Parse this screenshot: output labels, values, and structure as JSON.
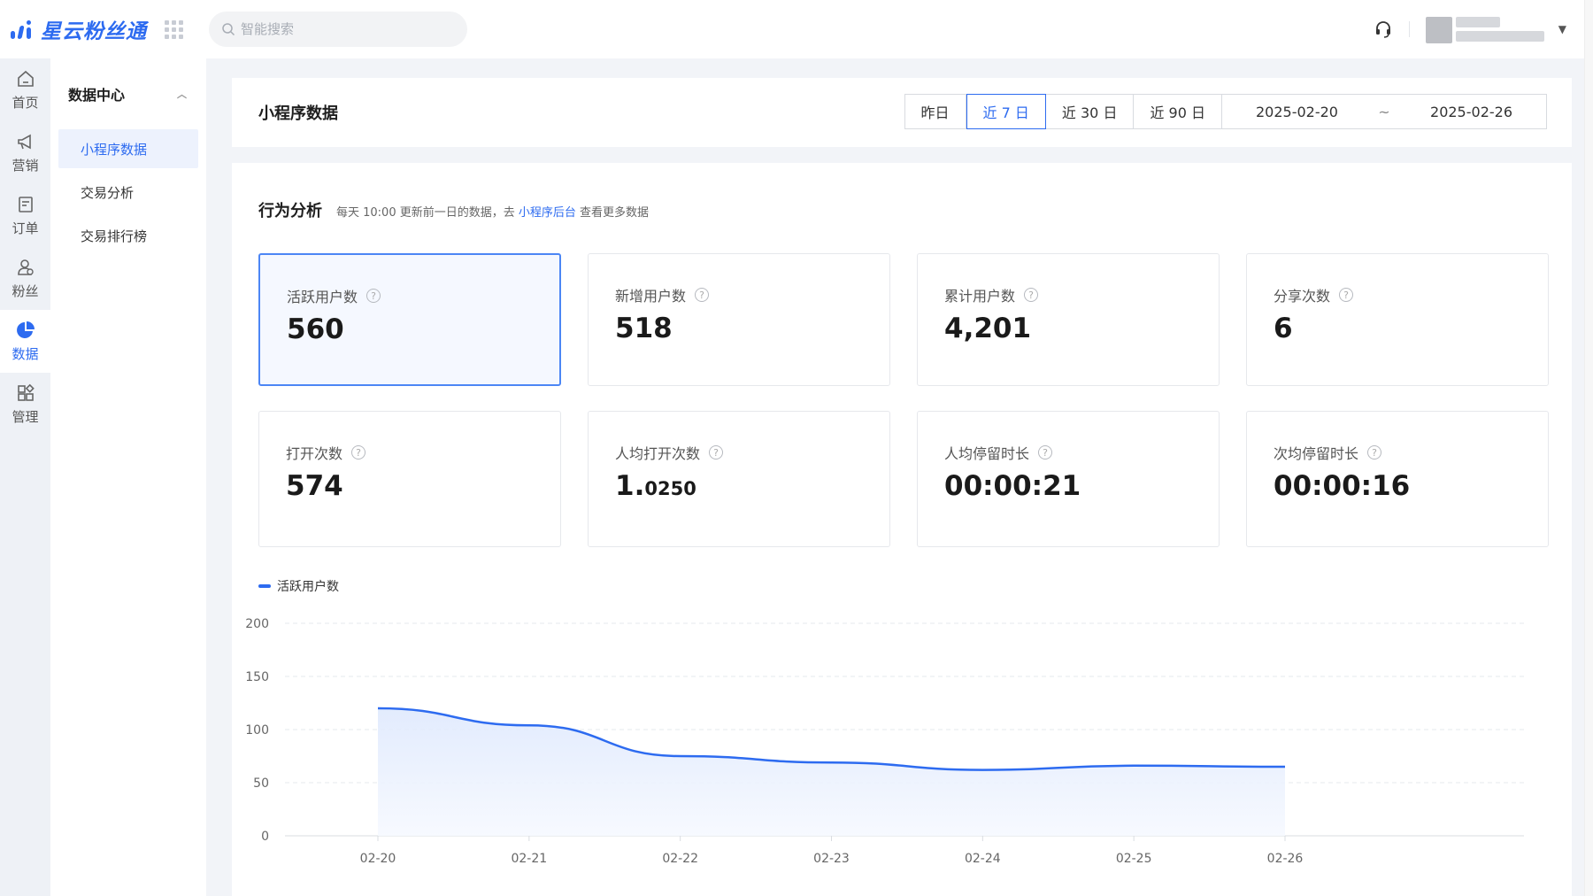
{
  "app": {
    "name": "星云粉丝通"
  },
  "search": {
    "placeholder": "智能搜索"
  },
  "rail": [
    {
      "label": "首页",
      "icon": "home-icon"
    },
    {
      "label": "营销",
      "icon": "megaphone-icon"
    },
    {
      "label": "订单",
      "icon": "order-icon"
    },
    {
      "label": "粉丝",
      "icon": "fans-icon"
    },
    {
      "label": "数据",
      "icon": "pie-chart-icon",
      "active": true
    },
    {
      "label": "管理",
      "icon": "grid-manage-icon"
    }
  ],
  "subnav": {
    "title": "数据中心",
    "items": [
      {
        "label": "小程序数据",
        "active": true
      },
      {
        "label": "交易分析"
      },
      {
        "label": "交易排行榜"
      }
    ]
  },
  "header": {
    "title": "小程序数据",
    "ranges": [
      "昨日",
      "近 7 日",
      "近 30 日",
      "近 90 日"
    ],
    "active_range": "近 7 日",
    "date_start": "2025-02-20",
    "date_sep": "~",
    "date_end": "2025-02-26"
  },
  "section": {
    "title": "行为分析",
    "note_prefix": "每天 10:00 更新前一日的数据，去",
    "note_link": "小程序后台",
    "note_suffix": "查看更多数据"
  },
  "metrics": [
    {
      "label": "活跃用户数",
      "value": "560",
      "selected": true
    },
    {
      "label": "新增用户数",
      "value": "518"
    },
    {
      "label": "累计用户数",
      "value": "4,201"
    },
    {
      "label": "分享次数",
      "value": "6"
    },
    {
      "label": "打开次数",
      "value": "574"
    },
    {
      "label": "人均打开次数",
      "value_int": "1.",
      "value_frac": "0250"
    },
    {
      "label": "人均停留时长",
      "value": "00:00:21"
    },
    {
      "label": "次均停留时长",
      "value": "00:00:16"
    }
  ],
  "colors": {
    "accent": "#2d6bf0",
    "area": "#eaf1fe"
  },
  "chart_data": {
    "type": "area",
    "legend": "活跃用户数",
    "x": [
      "02-20",
      "02-21",
      "02-22",
      "02-23",
      "02-24",
      "02-25",
      "02-26"
    ],
    "series": [
      {
        "name": "活跃用户数",
        "values": [
          120,
          104,
          75,
          69,
          62,
          66,
          65
        ]
      }
    ],
    "yticks": [
      "200",
      "150",
      "100",
      "50",
      "0"
    ],
    "ylim": [
      0,
      200
    ],
    "grid": true,
    "legend_position": "top-left"
  }
}
